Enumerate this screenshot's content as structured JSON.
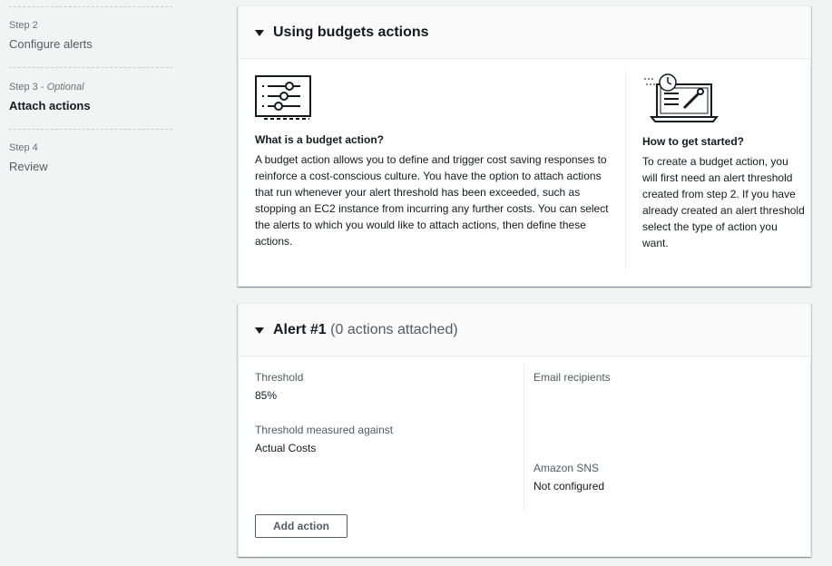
{
  "steps": [
    {
      "caption": "Step 2",
      "optional": "",
      "title": "Configure alerts",
      "active": false
    },
    {
      "caption": "Step 3 - ",
      "optional": "Optional",
      "title": "Attach actions",
      "active": true
    },
    {
      "caption": "Step 4",
      "optional": "",
      "title": "Review",
      "active": false
    }
  ],
  "info_panel": {
    "title": "Using budgets actions",
    "left": {
      "icon": "sliders-icon",
      "heading": "What is a budget action?",
      "text": "A budget action allows you to define and trigger cost saving responses to reinforce a cost-conscious culture. You have the option to attach actions that run whenever your alert threshold has been exceeded, such as stopping an EC2 instance from incurring any further costs. You can select the alerts to which you would like to attach actions, then define these actions."
    },
    "right": {
      "icon": "laptop-clock-icon",
      "heading": "How to get started?",
      "text": "To create a budget action, you will first need an alert threshold created from step 2. If you have already created an alert threshold select the type of action you want."
    }
  },
  "alert": {
    "title": "Alert #1",
    "subtitle": "(0 actions attached)",
    "threshold_label": "Threshold",
    "threshold_value": "85%",
    "measured_label": "Threshold measured against",
    "measured_value": "Actual Costs",
    "email_label": "Email recipients",
    "sns_label": "Amazon SNS",
    "sns_value": "Not configured",
    "add_action_label": "Add action"
  }
}
